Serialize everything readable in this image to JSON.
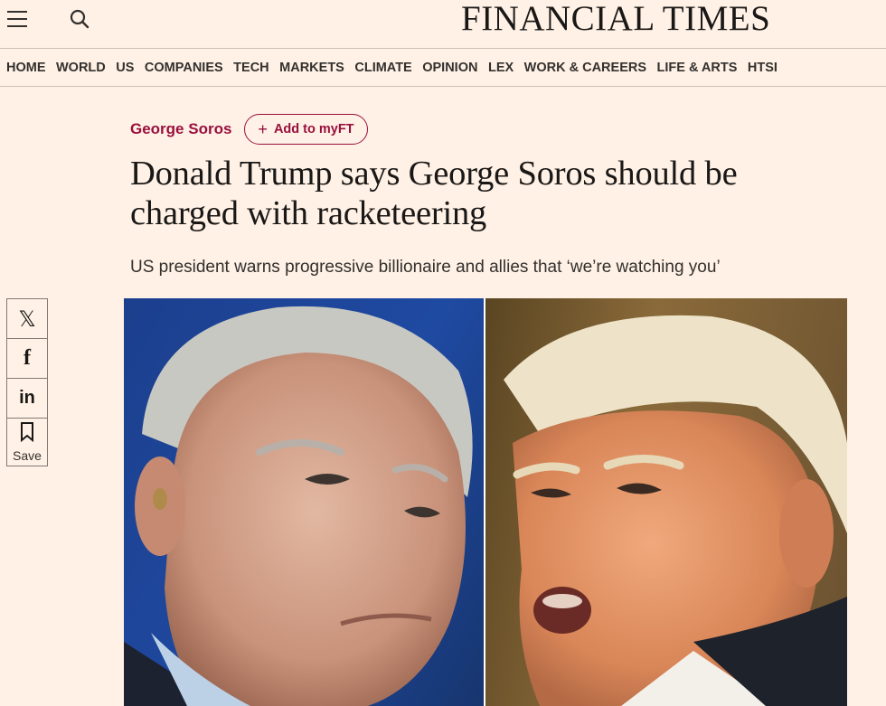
{
  "header": {
    "masthead": "FINANCIAL TIMES",
    "menu_icon": "hamburger-menu-icon",
    "search_icon": "search-icon"
  },
  "nav": {
    "items": [
      {
        "label": "HOME"
      },
      {
        "label": "WORLD"
      },
      {
        "label": "US"
      },
      {
        "label": "COMPANIES"
      },
      {
        "label": "TECH"
      },
      {
        "label": "MARKETS"
      },
      {
        "label": "CLIMATE"
      },
      {
        "label": "OPINION"
      },
      {
        "label": "LEX"
      },
      {
        "label": "WORK & CAREERS"
      },
      {
        "label": "LIFE & ARTS"
      },
      {
        "label": "HTSI"
      }
    ]
  },
  "article": {
    "topic": "George Soros",
    "add_myft_label": "Add to myFT",
    "headline": "Donald Trump says George Soros should be charged with racketeering",
    "standfirst": "US president warns progressive billionaire and allies that ‘we’re watching you’"
  },
  "share": {
    "x_icon": "x-icon",
    "facebook_icon": "facebook-icon",
    "linkedin_icon": "linkedin-icon",
    "save_icon": "bookmark-icon",
    "save_label": "Save"
  },
  "colors": {
    "background": "#fff1e5",
    "accent": "#990f3d",
    "text": "#33302e"
  }
}
